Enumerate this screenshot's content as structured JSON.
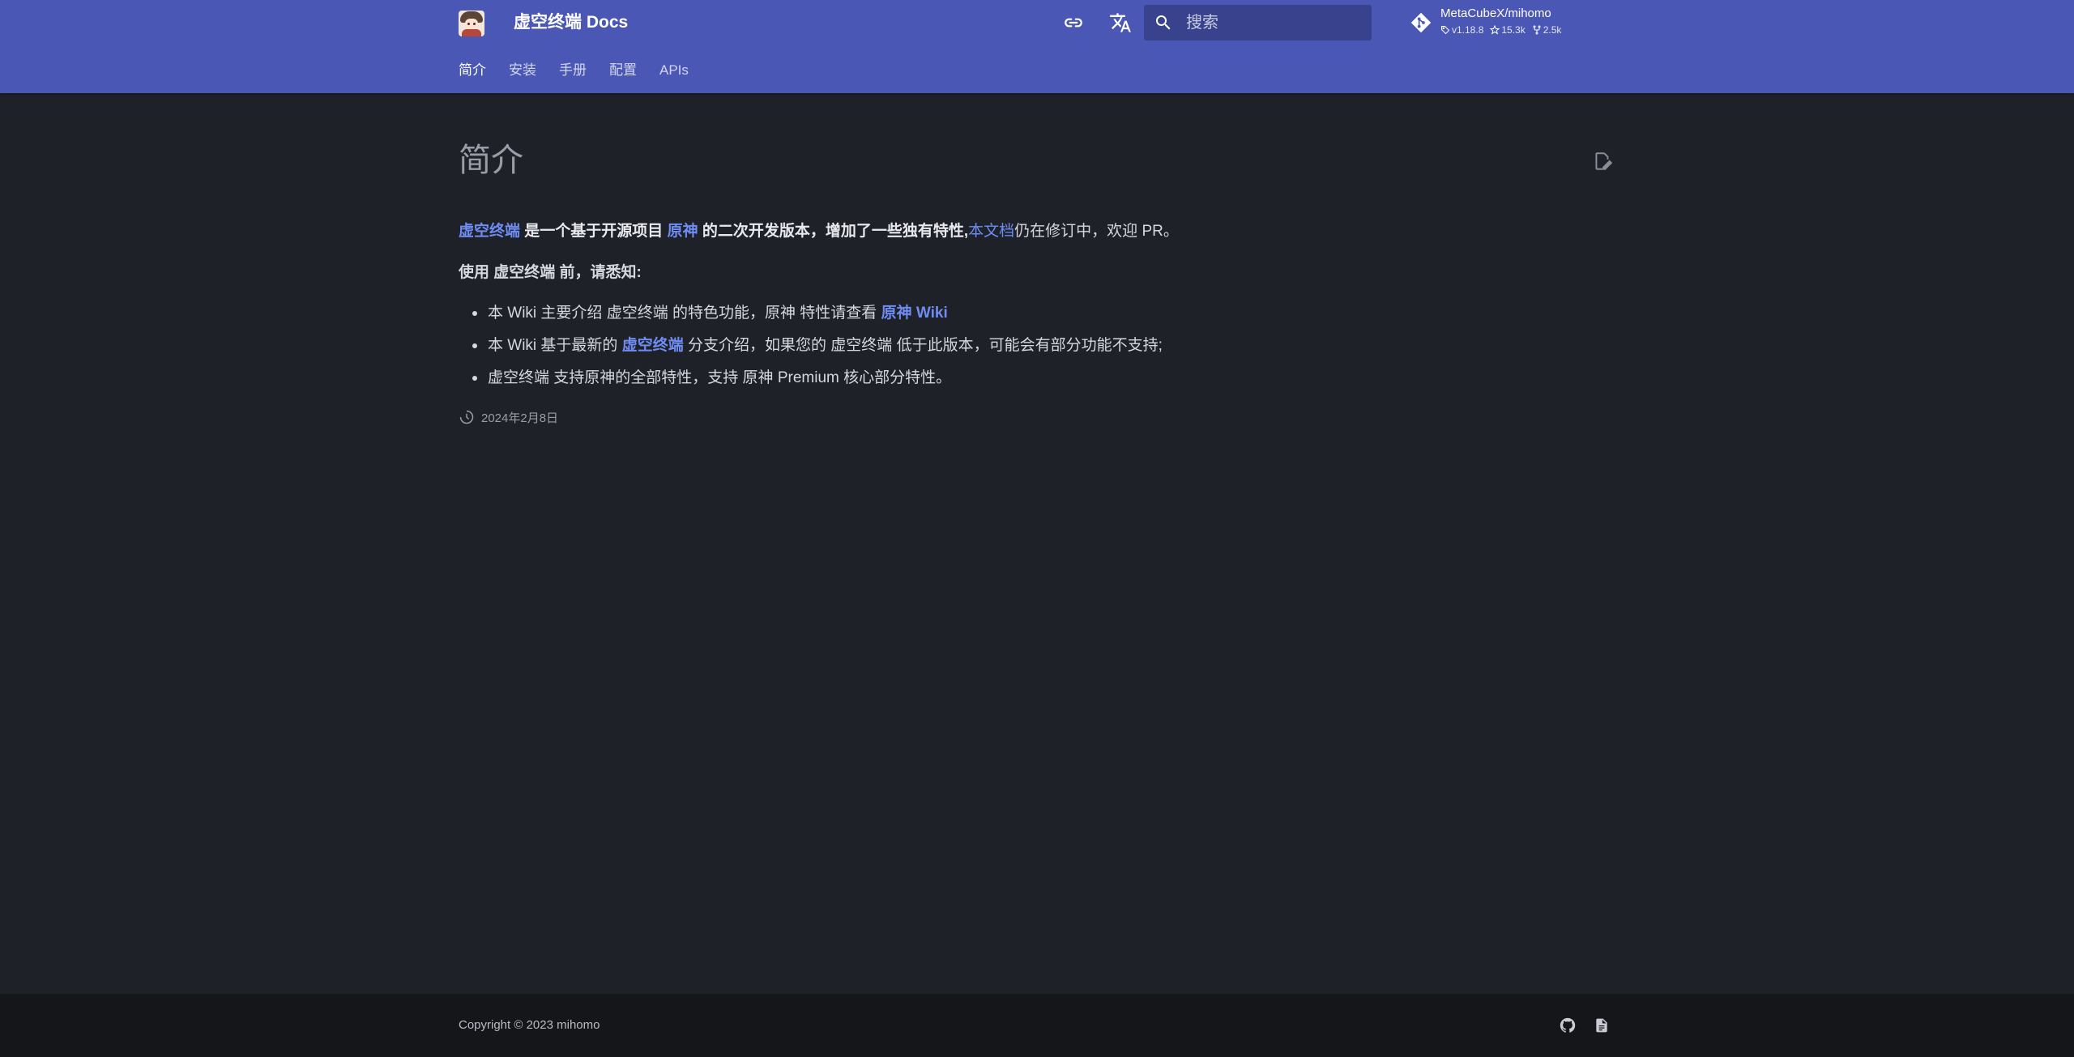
{
  "header": {
    "site_title": "虚空终端 Docs",
    "search_placeholder": "搜索",
    "repo": {
      "name": "MetaCubeX/mihomo",
      "version": "v1.18.8",
      "stars": "15.3k",
      "forks": "2.5k"
    },
    "tabs": [
      {
        "label": "简介",
        "active": true
      },
      {
        "label": "安装",
        "active": false
      },
      {
        "label": "手册",
        "active": false
      },
      {
        "label": "配置",
        "active": false
      },
      {
        "label": "APIs",
        "active": false
      }
    ]
  },
  "content": {
    "title": "简介",
    "intro": {
      "link1": "虚空终端",
      "text1": " 是一个基于开源项目 ",
      "link2": "原神",
      "text2": " 的二次开发版本，增加了一些独有特性,",
      "link3": "本文档",
      "text3": "仍在修订中，欢迎 PR。"
    },
    "notice": "使用 虚空终端 前，请悉知:",
    "list": [
      {
        "before": "本 Wiki 主要介绍 虚空终端 的特色功能，原神 特性请查看 ",
        "link": "原神 Wiki",
        "after": ""
      },
      {
        "before": "本 Wiki 基于最新的 ",
        "link": "虚空终端",
        "after": " 分支介绍，如果您的 虚空终端 低于此版本，可能会有部分功能不支持;"
      },
      {
        "before": "虚空终端 支持原神的全部特性，支持 原神 Premium 核心部分特性。",
        "link": "",
        "after": ""
      }
    ],
    "updated": "2024年2月8日"
  },
  "footer": {
    "copyright": "Copyright © 2023 mihomo"
  },
  "colors": {
    "header_bg": "#4a57b5",
    "page_bg": "#1f2129",
    "footer_bg": "#15161a",
    "link": "#6e8cf2"
  },
  "icons": [
    "logo",
    "link-icon",
    "translate-icon",
    "search-icon",
    "git-icon",
    "tag-icon",
    "star-icon",
    "fork-icon",
    "edit-icon",
    "clock-icon",
    "github-icon",
    "document-icon"
  ]
}
